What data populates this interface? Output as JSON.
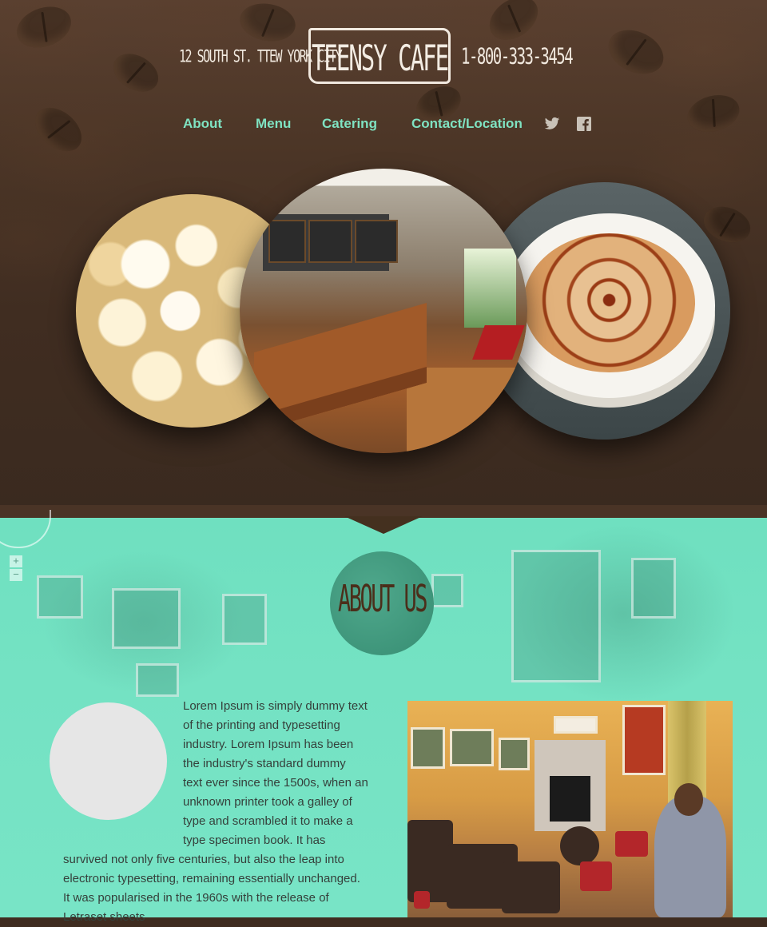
{
  "header": {
    "address": "12 SOUTH ST. TTEW YORK CITY",
    "logo": "TEENSY CAFE",
    "phone": "1-800-333-3454"
  },
  "nav": {
    "items": [
      {
        "label": "About"
      },
      {
        "label": "Menu"
      },
      {
        "label": "Catering"
      },
      {
        "label": "Contact/Location"
      }
    ],
    "social": [
      {
        "icon": "twitter-icon"
      },
      {
        "icon": "facebook-icon"
      }
    ],
    "link_color": "#7fe3c2"
  },
  "gallery": [
    {
      "icon": "popcorn-photo"
    },
    {
      "icon": "cafe-interior-photo"
    },
    {
      "icon": "latte-photo"
    }
  ],
  "about": {
    "heading": "ABOUT US",
    "text": "Lorem Ipsum is simply dummy text of the printing and typesetting industry. Lorem Ipsum has been the industry's standard dummy text ever since the 1500s, when an unknown printer took a galley of type and scrambled it to make a type specimen book. It has survived not only five centuries, but also the leap into electronic typesetting, remaining essentially unchanged. It was popularised in the 1960s with the release of Letraset sheets",
    "map_zoom_in": "+",
    "map_zoom_out": "−",
    "accent_color": "#74e2c3"
  }
}
